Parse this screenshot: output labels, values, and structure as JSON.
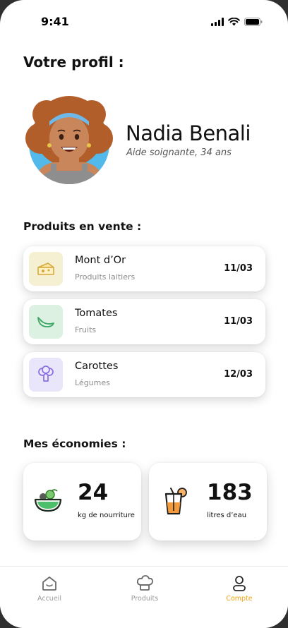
{
  "status_bar": {
    "time": "9:41"
  },
  "profile": {
    "section_title": "Votre profil :",
    "name": "Nadia Benali",
    "subtitle": "Aide soignante, 34 ans"
  },
  "products": {
    "section_title": "Produits en vente :",
    "items": [
      {
        "name": "Mont d’Or",
        "category": "Produits laitiers",
        "date": "11/03",
        "icon": "cheese-icon",
        "bg": "#f5f0d2"
      },
      {
        "name": "Tomates",
        "category": "Fruits",
        "date": "11/03",
        "icon": "leaf-icon",
        "bg": "#dcf1e2"
      },
      {
        "name": "Carottes",
        "category": "Légumes",
        "date": "12/03",
        "icon": "broccoli-icon",
        "bg": "#e9e6fb"
      }
    ]
  },
  "savings": {
    "section_title": "Mes économies :",
    "items": [
      {
        "value": "24",
        "label": "kg de nourriture",
        "icon": "salad-bowl-icon"
      },
      {
        "value": "183",
        "label": "litres d’eau",
        "icon": "drink-glass-icon"
      }
    ]
  },
  "nav": {
    "items": [
      {
        "label": "Accueil",
        "icon": "home-icon",
        "active": false
      },
      {
        "label": "Produits",
        "icon": "chef-hat-icon",
        "active": false
      },
      {
        "label": "Compte",
        "icon": "user-icon",
        "active": true
      }
    ]
  },
  "colors": {
    "accent": "#f2a20c",
    "muted": "#9a9a9a"
  }
}
